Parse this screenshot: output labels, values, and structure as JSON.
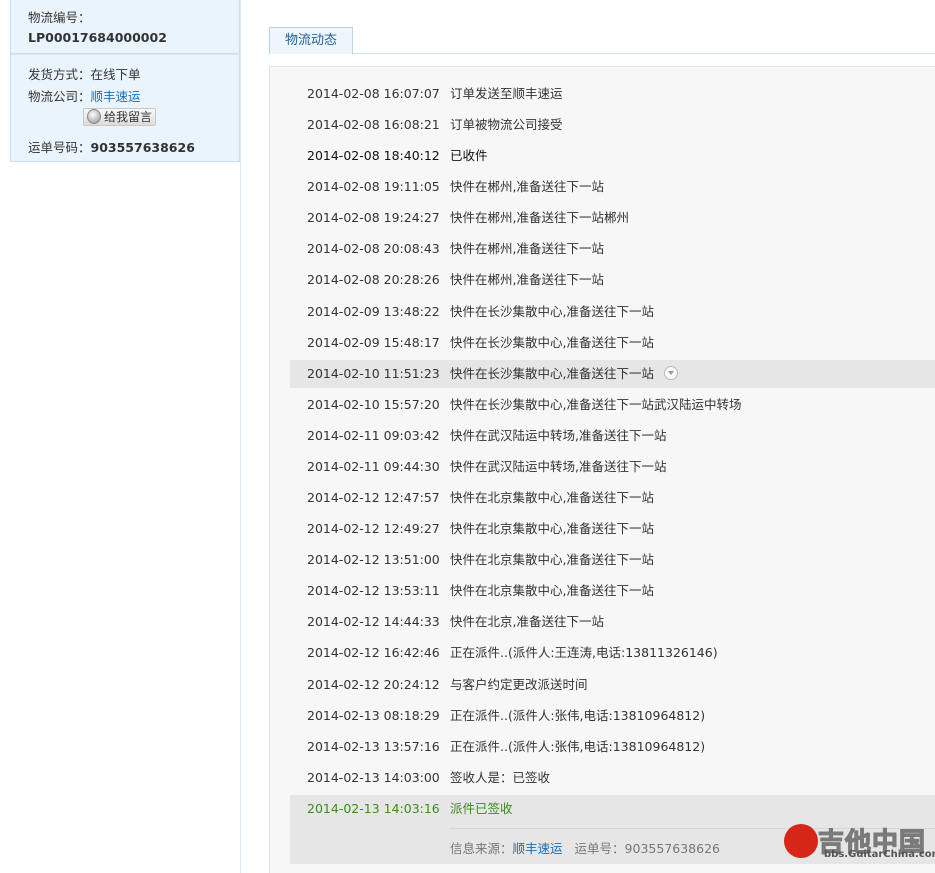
{
  "sidebar": {
    "logistics_no_label": "物流编号：",
    "logistics_no": "LP00017684000002",
    "ship_method_label": "发货方式：",
    "ship_method": "在线下单",
    "company_label": "物流公司：",
    "company": "顺丰速运",
    "message_button": "给我留言",
    "waybill_label": "运单号码：",
    "waybill": "903557638626"
  },
  "tab": {
    "label": "物流动态"
  },
  "events": [
    {
      "time": "2014-02-08 16:07:07",
      "desc": "订单发送至顺丰速运"
    },
    {
      "time": "2014-02-08 16:08:21",
      "desc": "订单被物流公司接受"
    },
    {
      "time": "2014-02-08 18:40:12",
      "desc": "已收件"
    },
    {
      "time": "2014-02-08 19:11:05",
      "desc": "快件在郴州,准备送往下一站"
    },
    {
      "time": "2014-02-08 19:24:27",
      "desc": "快件在郴州,准备送往下一站郴州"
    },
    {
      "time": "2014-02-08 20:08:43",
      "desc": "快件在郴州,准备送往下一站"
    },
    {
      "time": "2014-02-08 20:28:26",
      "desc": "快件在郴州,准备送往下一站"
    },
    {
      "time": "2014-02-09 13:48:22",
      "desc": "快件在长沙集散中心,准备送往下一站"
    },
    {
      "time": "2014-02-09 15:48:17",
      "desc": "快件在长沙集散中心,准备送往下一站"
    },
    {
      "time": "2014-02-10 11:51:23",
      "desc": "快件在长沙集散中心,准备送往下一站"
    },
    {
      "time": "2014-02-10 15:57:20",
      "desc": "快件在长沙集散中心,准备送往下一站武汉陆运中转场"
    },
    {
      "time": "2014-02-11 09:03:42",
      "desc": "快件在武汉陆运中转场,准备送往下一站"
    },
    {
      "time": "2014-02-11 09:44:30",
      "desc": "快件在武汉陆运中转场,准备送往下一站"
    },
    {
      "time": "2014-02-12 12:47:57",
      "desc": "快件在北京集散中心,准备送往下一站"
    },
    {
      "time": "2014-02-12 12:49:27",
      "desc": "快件在北京集散中心,准备送往下一站"
    },
    {
      "time": "2014-02-12 13:51:00",
      "desc": "快件在北京集散中心,准备送往下一站"
    },
    {
      "time": "2014-02-12 13:53:11",
      "desc": "快件在北京集散中心,准备送往下一站"
    },
    {
      "time": "2014-02-12 14:44:33",
      "desc": "快件在北京,准备送往下一站"
    },
    {
      "time": "2014-02-12 16:42:46",
      "desc": "正在派件..(派件人:王连涛,电话:13811326146)"
    },
    {
      "time": "2014-02-12 20:24:12",
      "desc": "与客户约定更改派送时间"
    },
    {
      "time": "2014-02-13 08:18:29",
      "desc": "正在派件..(派件人:张伟,电话:13810964812)"
    },
    {
      "time": "2014-02-13 13:57:16",
      "desc": "正在派件..(派件人:张伟,电话:13810964812)"
    },
    {
      "time": "2014-02-13 14:03:00",
      "desc": "签收人是：已签收"
    },
    {
      "time": "2014-02-13 14:03:16",
      "desc": "派件已签收"
    }
  ],
  "source": {
    "label": "信息来源：",
    "company": "顺丰速运",
    "waybill_label": "运单号：",
    "waybill": "903557638626"
  },
  "watermark": {
    "big": "吉他中国",
    "small": "bbs.GuitarChina.com"
  },
  "colors": {
    "accent": "#1a6db3",
    "latest": "#3f8a1f",
    "highlight_row": "#e6e6e6"
  }
}
